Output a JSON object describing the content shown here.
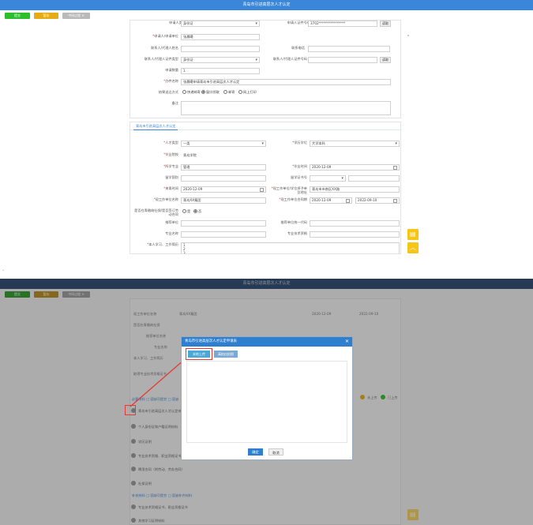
{
  "header": {
    "title": "青岛市引进高层次人才认定"
  },
  "toolbar": {
    "btn1": "提交",
    "btn2": "暂存",
    "btn3": "中间过程 ✕"
  },
  "form1": {
    "row0_left_label": "申请人类型",
    "row0_left_value": "身份证",
    "row0_right_label": "申请人证件号码",
    "row0_right_value": "3702****************",
    "row0_btn": "读取",
    "applicant_label": "申请人/申请单位",
    "applicant_value": "张晨曦",
    "contact_label": "联系人/代理人姓名",
    "phone_label": "联系电话",
    "id_type_label": "联系人/代理人证件类型",
    "id_type_value": "身份证",
    "id_no_label": "联系人/代理人证件号码",
    "read_btn": "读取",
    "qty_label": "申请数量",
    "qty_value": "1",
    "item_label": "办件名称",
    "item_value": "张晨曦申请青岛市引进高层次人才认定",
    "delivery_label": "结果送达方式",
    "delivery_options": [
      "快递邮寄",
      "窗口领取",
      "邮寄",
      "网上打印"
    ],
    "note_label": "备注"
  },
  "tab": {
    "label": "青岛市引进高层次人才认定"
  },
  "form2": {
    "talent_type_label": "人才类型",
    "talent_type_value": "一类",
    "degree_label": "学历学位",
    "degree_value": "大学本科",
    "school_label": "毕业院校",
    "school_value": "青岛学院",
    "major_label": "所学专业",
    "major_value": "管理",
    "grad_date_label": "毕业时间",
    "grad_date_value": "2020-12-09",
    "abroad_label": "留学国别",
    "abroad_cert_label": "留学证书号",
    "join_date_label": "来青时间",
    "join_date_value": "2020-12-09",
    "unit_label": "现工作单位名称",
    "unit_value": "青岛XX集团",
    "unit_addr_label": "现工作单位/学位授予单位地址",
    "unit_addr_value": "青岛市市南区XX路",
    "contract_label": "现工作单位合同期",
    "contract_from": "2020-12-09",
    "contract_to": "2022-09-10",
    "social_label": "是否在青缴纳社保/是否签订劳动合同",
    "social_yes": "是",
    "social_no": "否",
    "ins_label": "推荐单位",
    "ins_no_label": "推荐单位统一代码",
    "ins2_label": "专业名称",
    "ins2_no_label": "专业技术资格",
    "resume_label": "本人学习、工作简历",
    "resume_value": "1\n2\n3"
  },
  "sidebar": {
    "icon1": "▤",
    "icon2": "︿"
  },
  "shot2": {
    "bg_labels": [
      "现工作单位名称",
      "是否在青缴纳社保",
      "推荐单位名称",
      "专业名称",
      "本人学习、工作简历",
      "取得专业技术资格证书",
      "青岛XX集团",
      "2020-12-09",
      "2022-09-10"
    ],
    "list_items": [
      "青岛市引进高层次人才认定申请表",
      "个人身份证和户籍证明材料",
      "学历证明",
      "专业技术资格、职业资格证书",
      "聘用合同（附劳动、劳务合同）",
      "社保证明",
      "专业技术资格证书、职业资格证书",
      "其他学习证明材料"
    ],
    "section1": "必要材料 □ 容缺可提交 □ 容缺",
    "section2": "补充材料 □ 容缺可提交 □ 容缺补齐材料",
    "legend": [
      "未上传",
      "已上传"
    ]
  },
  "modal": {
    "title": "青岛市引进高层次人才认定申请表",
    "upload_btn": "本地上传",
    "scan_btn": "高拍仪拍照",
    "ok": "确定",
    "cancel": "取消"
  },
  "colors": {
    "accent": "#3a86d9",
    "green": "#2bbf2b",
    "orange": "#e6ac15",
    "red": "#e53935"
  }
}
